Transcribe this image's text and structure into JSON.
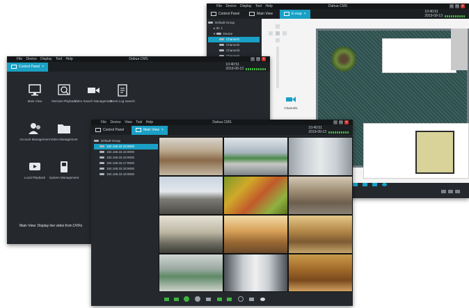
{
  "colors": {
    "accent": "#1aa0c5",
    "status_green": "#3fb53f",
    "close": "#c8302c"
  },
  "window_left": {
    "title": "Dahua CMS",
    "menu": [
      "File",
      "Device",
      "Display",
      "Tool",
      "Help"
    ],
    "tab": "Control Panel",
    "clock": {
      "time": "10:40:51",
      "date": "2019-09-13",
      "cpu": "CPU"
    },
    "icons": [
      {
        "label": "Main View",
        "icon": "monitor-icon"
      },
      {
        "label": "Remote Playback",
        "icon": "playback-icon"
      },
      {
        "label": "Video Search Management",
        "icon": "camera-icon"
      },
      {
        "label": "Event Log Search",
        "icon": "document-icon"
      },
      {
        "label": "Account Management",
        "icon": "users-icon"
      },
      {
        "label": "Video Management",
        "icon": "folder-icon"
      },
      {
        "label": "Local Playback",
        "icon": "local-playback-icon"
      },
      {
        "label": "System Management",
        "icon": "phone-icon"
      }
    ],
    "status": "Main View: Display live video from DVRs"
  },
  "window_right": {
    "title": "Dahua CMS",
    "menu": [
      "File",
      "Device",
      "Display",
      "Tool",
      "Help"
    ],
    "tabs": [
      "Control Panel",
      "Main View",
      "E-map"
    ],
    "clock": {
      "time": "10:40:51",
      "date": "2019-09-13",
      "cpu": "CPU"
    },
    "tree": {
      "root": "Default Group",
      "items": [
        "ID: 1",
        "Device",
        "Channel1",
        "Channel2",
        "Channel3",
        "Channel4"
      ]
    },
    "map_item_label": "Channel1",
    "icons": [
      "zoom-in-icon",
      "zoom-out-icon",
      "locate-icon",
      "refresh-icon"
    ]
  },
  "window_front": {
    "title": "Dahua CMS",
    "menu": [
      "File",
      "Device",
      "View",
      "Tool",
      "Help"
    ],
    "tabs": [
      "Control Panel",
      "Main View"
    ],
    "clock": {
      "time": "10:40:51",
      "date": "2019-09-13",
      "cpu": "CPU"
    },
    "tree": {
      "root": "Default Group",
      "items": [
        "192.168.33.15:9000",
        "192.168.33.15:9000",
        "192.168.33.16:9000",
        "192.168.33.17:9000",
        "192.168.33.18:9000",
        "192.168.33.19:9000"
      ]
    },
    "toolbar_icons": [
      "layout-icon",
      "screen-icon",
      "record-icon",
      "stop-icon",
      "snapshot-icon",
      "prev-icon",
      "next-icon",
      "sequence-icon",
      "audio-icon",
      "light-icon"
    ],
    "grid_scenes": [
      "supermarket",
      "station",
      "elevator",
      "airport",
      "fruit-market",
      "street",
      "mall",
      "shopping-center",
      "hall",
      "factory",
      "metro",
      "library"
    ]
  }
}
